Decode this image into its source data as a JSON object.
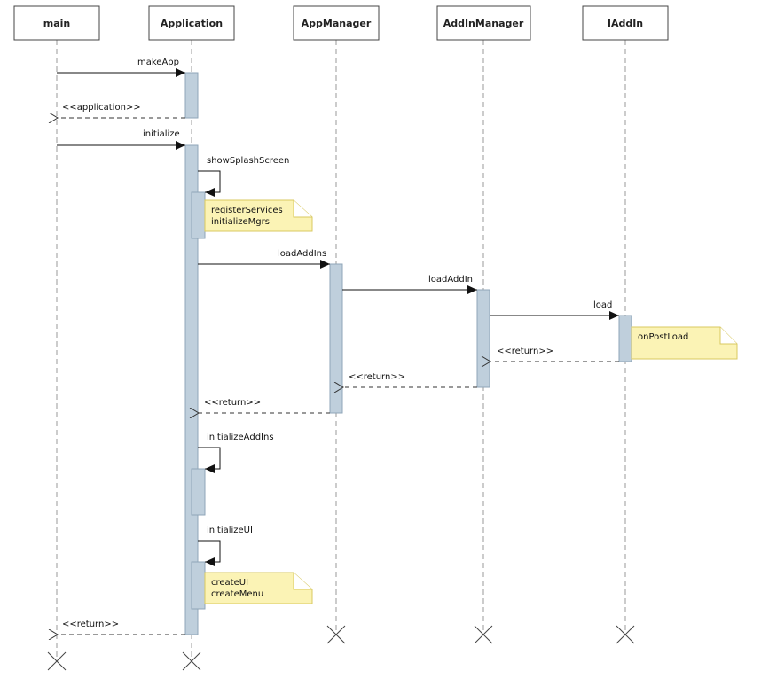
{
  "participants": [
    "main",
    "Application",
    "AppManager",
    "AddInManager",
    "IAddIn"
  ],
  "messages": {
    "makeApp": "makeApp",
    "application_return": "<<application>>",
    "initialize": "initialize",
    "showSplashScreen": "showSplashScreen",
    "loadAddIns": "loadAddIns",
    "loadAddIn": "loadAddIn",
    "load": "load",
    "return_iaddin": "<<return>>",
    "return_addinmanager": "<<return>>",
    "return_appmanager": "<<return>>",
    "initializeAddIns": "initializeAddIns",
    "initializeUI": "initializeUI",
    "return_main": "<<return>>"
  },
  "notes": {
    "splash": [
      "registerServices",
      "initializeMgrs"
    ],
    "postload": [
      "onPostLoad"
    ],
    "ui": [
      "createUI",
      "createMenu"
    ]
  },
  "colors": {
    "activation": "#bfcfdc",
    "note": "#fbf3b5"
  }
}
